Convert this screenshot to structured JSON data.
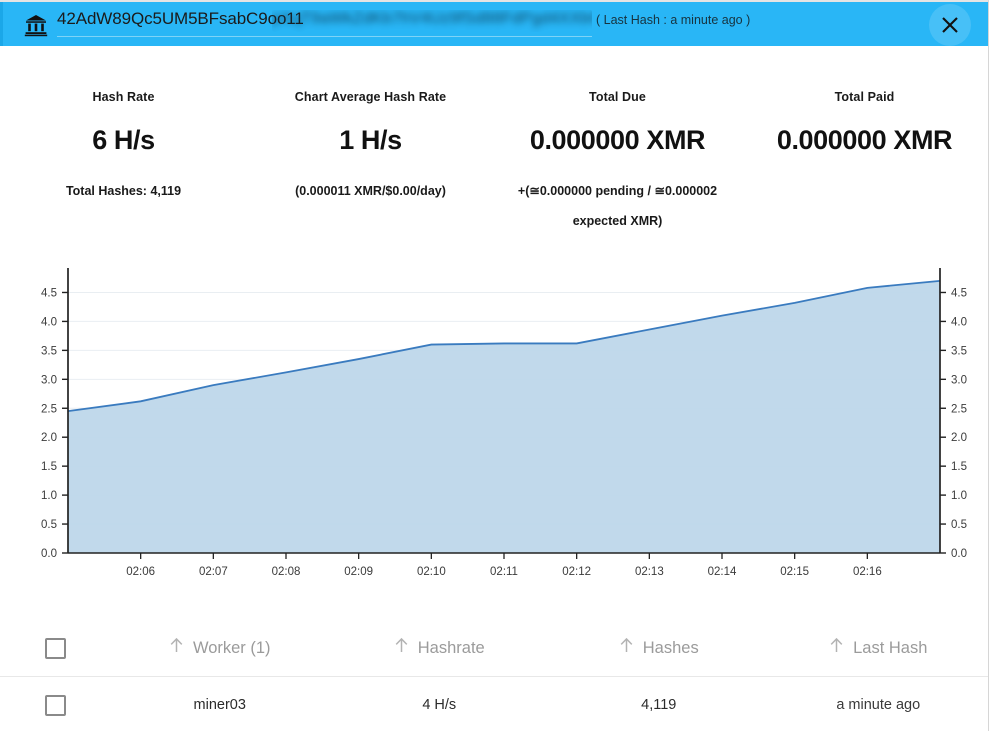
{
  "header": {
    "icon": "bank-icon",
    "address_visible": "42AdW89Qc5UM5BFsabC9oo11",
    "address_redacted": "pXqT9aWkZdKb7hV4Uz9fSd88FdPgd4XXbC6q9k",
    "last_hash_text": "( Last Hash : a minute ago )",
    "close_label": "✕",
    "bar_color": "#29b6f6"
  },
  "stats": [
    {
      "label": "Hash Rate",
      "value": "6 H/s",
      "sub": "Total Hashes: 4,119"
    },
    {
      "label": "Chart Average Hash Rate",
      "value": "1 H/s",
      "sub": "(0.000011 XMR/$0.00/day)"
    },
    {
      "label": "Total Due",
      "value": "0.000000 XMR",
      "sub": "+(≅0.000000 pending / ≅0.000002 expected XMR)"
    },
    {
      "label": "Total Paid",
      "value": "0.000000 XMR",
      "sub": ""
    }
  ],
  "chart_data": {
    "type": "area",
    "title": "",
    "xlabel": "",
    "ylabel": "",
    "ylim": [
      0.0,
      4.75
    ],
    "grid": true,
    "legend": null,
    "line_color": "#3a7bbf",
    "fill_color": "#bed7ea",
    "y_ticks": [
      0.0,
      0.5,
      1.0,
      1.5,
      2.0,
      2.5,
      3.0,
      3.5,
      4.0,
      4.5
    ],
    "y_tick_labels": [
      "0.0",
      "0.5",
      "1.0",
      "1.5",
      "2.0",
      "2.5",
      "3.0",
      "3.5",
      "4.0",
      "4.5"
    ],
    "y_axis_right_mirrored": true,
    "x_tick_labels": [
      "02:06",
      "02:07",
      "02:08",
      "02:09",
      "02:10",
      "02:11",
      "02:12",
      "02:13",
      "02:14",
      "02:15",
      "02:16"
    ],
    "x": [
      "02:05:40",
      "02:06",
      "02:07",
      "02:08",
      "02:09",
      "02:10",
      "02:11",
      "02:12",
      "02:13",
      "02:14",
      "02:15",
      "02:16",
      "02:16:50"
    ],
    "values": [
      2.45,
      2.62,
      2.9,
      3.12,
      3.35,
      3.6,
      3.62,
      3.62,
      3.86,
      4.1,
      4.32,
      4.58,
      4.7
    ]
  },
  "table": {
    "columns": [
      {
        "label": "Worker (1)",
        "sort_icon": "sort-up-icon"
      },
      {
        "label": "Hashrate",
        "sort_icon": "sort-up-icon"
      },
      {
        "label": "Hashes",
        "sort_icon": "sort-up-icon"
      },
      {
        "label": "Last Hash",
        "sort_icon": "sort-up-icon"
      }
    ],
    "rows": [
      {
        "worker": "miner03",
        "hashrate": "4 H/s",
        "hashes": "4,119",
        "last_hash": "a minute ago"
      }
    ]
  }
}
